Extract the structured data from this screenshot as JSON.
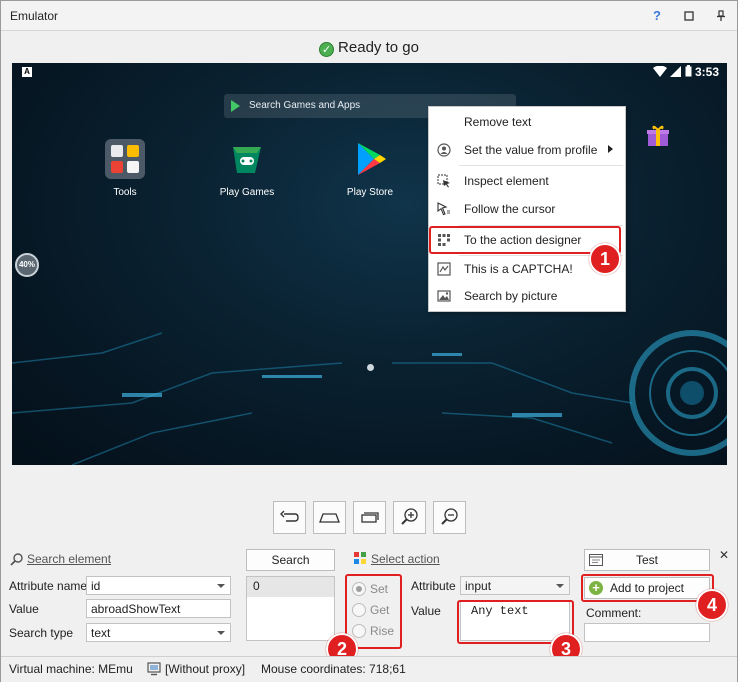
{
  "window": {
    "title": "Emulator",
    "help": "?",
    "maximize": "☐",
    "pin": "⊥"
  },
  "status": {
    "ready": "Ready to go",
    "ready_icon": "check-circle-icon"
  },
  "android": {
    "status_bar": {
      "app_badge": "A",
      "time": "3:53"
    },
    "search_placeholder": "Search Games and Apps",
    "apps": [
      {
        "label": "Tools",
        "icon": "tools-folder-icon"
      },
      {
        "label": "Play Games",
        "icon": "play-games-icon"
      },
      {
        "label": "Play Store",
        "icon": "play-store-icon"
      }
    ],
    "battery_level": "40%"
  },
  "context_menu": {
    "items": [
      {
        "label": "Remove text",
        "icon": ""
      },
      {
        "label": "Set the value from profile",
        "icon": "profile-icon",
        "submenu": true
      },
      {
        "label": "Inspect element",
        "icon": "inspect-icon"
      },
      {
        "label": "Follow the cursor",
        "icon": "cursor-icon"
      },
      {
        "label": "To the action designer",
        "icon": "grid-icon"
      },
      {
        "label": "This is a CAPTCHA!",
        "icon": "captcha-icon"
      },
      {
        "label": "Search by picture",
        "icon": "picture-icon"
      }
    ]
  },
  "callouts": [
    "1",
    "2",
    "3",
    "4"
  ],
  "controls": [
    "back",
    "home",
    "recents",
    "zoom-in",
    "zoom-out"
  ],
  "search_panel": {
    "search_element_link": "Search element",
    "attribute_name_label": "Attribute name",
    "attribute_name_value": "id",
    "value_label": "Value",
    "value_value": "abroadShowText",
    "search_type_label": "Search type",
    "search_type_value": "text",
    "search_button": "Search",
    "result_value": "0"
  },
  "action_panel": {
    "select_action_link": "Select action",
    "radios": [
      {
        "label": "Set",
        "checked": true
      },
      {
        "label": "Get",
        "checked": false
      },
      {
        "label": "Rise",
        "checked": false
      }
    ],
    "attribute_label": "Attribute",
    "attribute_value": "input",
    "value_label": "Value",
    "value_text": "Any text"
  },
  "right_panel": {
    "test_button": "Test",
    "add_to_project_button": "Add to project",
    "comment_label": "Comment:",
    "close": "✕"
  },
  "statusbar": {
    "virtual_machine": "Virtual machine: MEmu",
    "proxy": "[Without proxy]",
    "mouse_coordinates": "Mouse coordinates: 718;61"
  },
  "colors": {
    "callout_red": "#e02020",
    "ok_green": "#4caf50",
    "screen_bg": "#0a2232"
  }
}
